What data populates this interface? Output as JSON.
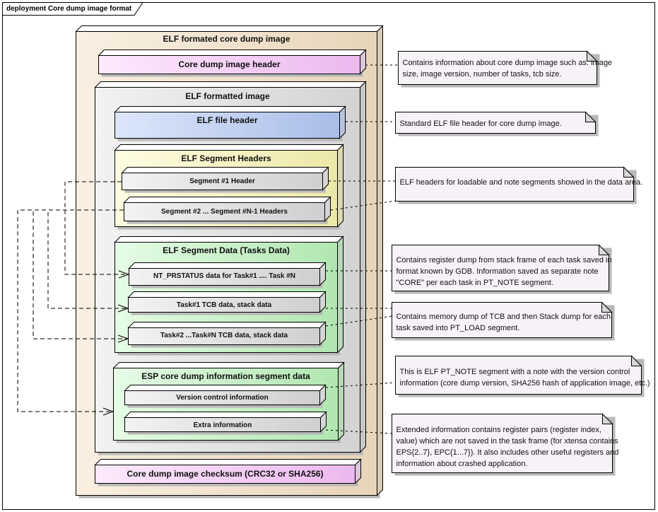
{
  "frame": {
    "label": "deployment Core dump image format"
  },
  "colors": {
    "outer_node": "#f8eedf",
    "outer_node_end": "#e8d7bd",
    "pink_node": "#fbe6fb",
    "pink_node_end": "#eebcf0",
    "gray_node": "#efefef",
    "gray_node_end": "#d6d6d6",
    "blue_node": "#d8e4fa",
    "blue_node_end": "#aebfe8",
    "yellow_node": "#fdfbdc",
    "yellow_node_end": "#eeeab0",
    "green_node": "#e2fbe2",
    "green_node_end": "#b4e8b4",
    "note_fill": "#f7f2f7"
  },
  "nodes": {
    "elf_core_dump_image": "ELF formated core dump image",
    "core_dump_header": "Core dump image header",
    "elf_formatted_image": "ELF formatted image",
    "elf_file_header": "ELF file header",
    "elf_segment_headers": "ELF Segment Headers",
    "segment1_header": "Segment #1 Header",
    "segment2_headers": "Segment #2 ... Segment #N-1 Headers",
    "elf_segment_data": "ELF Segment Data (Tasks Data)",
    "nt_prstatus": "NT_PRSTATUS data for Task#1 .... Task #N",
    "task1_tcb": "Task#1 TCB data, stack data",
    "task2_tcb": "Task#2 ...Task#N TCB data,  stack data",
    "esp_info_segment": "ESP core dump information segment data",
    "version_control": "Version control information",
    "extra_info": "Extra information",
    "checksum": "Core dump image checksum (CRC32 or SHA256)"
  },
  "notes": [
    {
      "id": "note-header",
      "lines": [
        "Contains information about core dump image such as: image",
        "size, image version, number of tasks, tcb size."
      ]
    },
    {
      "id": "note-elf-header",
      "lines": [
        "Standard ELF file header for core dump image."
      ]
    },
    {
      "id": "note-segment-headers",
      "lines": [
        "ELF headers for loadable and note segments showed in the data area."
      ]
    },
    {
      "id": "note-nt-prstatus",
      "lines": [
        "Contains register dump from stack frame of each task saved in",
        "format known by GDB. Information saved as separate note",
        "\"CORE\" per each task in PT_NOTE segment."
      ]
    },
    {
      "id": "note-tcb",
      "lines": [
        "Contains memory dump of TCB and then Stack dump for each",
        "task saved into PT_LOAD segment."
      ]
    },
    {
      "id": "note-version",
      "lines": [
        "This is ELF PT_NOTE segment with a note with the version control",
        "information (core dump version, SHA256 hash of application image, etc.)"
      ]
    },
    {
      "id": "note-extra",
      "lines": [
        "Extended information contains register pairs (register index,",
        "value) which are not saved in the task frame (for xtensa contains",
        "EPS{2..7}, EPC{1...7}). It also includes other useful registers and",
        "information about crashed application."
      ]
    }
  ]
}
